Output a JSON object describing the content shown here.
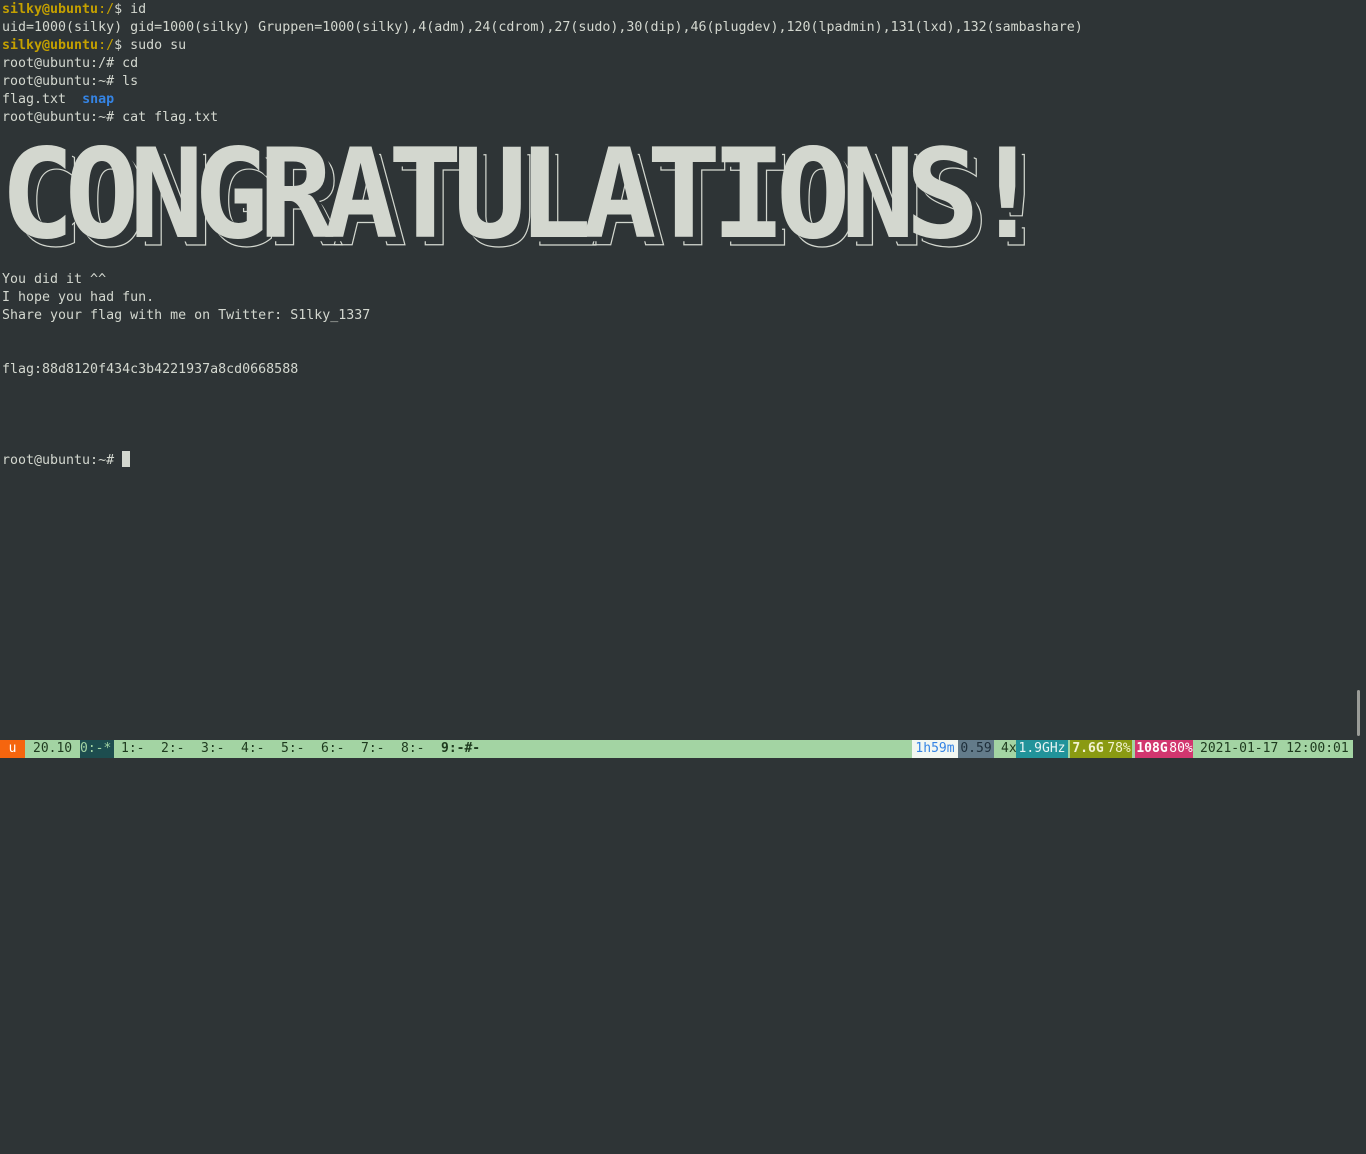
{
  "terminal": {
    "lines": [
      {
        "user": "silky@ubuntu",
        "path": ":/",
        "rest": "$ id"
      },
      {
        "text": "uid=1000(silky) gid=1000(silky) Gruppen=1000(silky),4(adm),24(cdrom),27(sudo),30(dip),46(plugdev),120(lpadmin),131(lxd),132(sambashare)"
      },
      {
        "user": "silky@ubuntu",
        "path": ":/",
        "rest": "$ sudo su"
      },
      {
        "text": "root@ubuntu:/# cd"
      },
      {
        "text": "root@ubuntu:~# ls"
      },
      {
        "file": "flag.txt",
        "dir": "snap"
      },
      {
        "text": "root@ubuntu:~# cat flag.txt"
      }
    ],
    "banner": "CONGRATULATIONS!",
    "message_lines": [
      "You did it ^^",
      "I hope you had fun.",
      "Share your flag with me on Twitter: S1lky_1337"
    ],
    "flag_line": "flag:88d8120f434c3b4221937a8cd0668588",
    "final_prompt": "root@ubuntu:~# "
  },
  "statusbar": {
    "session_badge": "u",
    "version": "20.10",
    "windows": [
      {
        "label": "0:-*",
        "current": false,
        "active_style": true
      },
      {
        "label": "1:-"
      },
      {
        "label": "2:-"
      },
      {
        "label": "3:-"
      },
      {
        "label": "4:-"
      },
      {
        "label": "5:-"
      },
      {
        "label": "6:-"
      },
      {
        "label": "7:-"
      },
      {
        "label": "8:-"
      },
      {
        "label": "9:-#-",
        "current": true
      }
    ],
    "uptime": "1h59m",
    "load": "0.59",
    "cpu_count": "4x",
    "cpu_freq": "1.9GHz",
    "mem_used": "7.6G",
    "mem_pct": "78%",
    "disk_used": "108G",
    "disk_pct": "80%",
    "datetime": "2021-01-17 12:00:01",
    "colors": {
      "bar_bg": "#a3d4a3",
      "session_badge_bg": "#f5650e",
      "window0_bg": "#1d4d4f",
      "uptime_bg": "#f2f7f2",
      "load_bg": "#637b8a",
      "freq_bg": "#21939a",
      "mem_bg": "#8a9a12",
      "disk_bg": "#d2366f"
    }
  }
}
